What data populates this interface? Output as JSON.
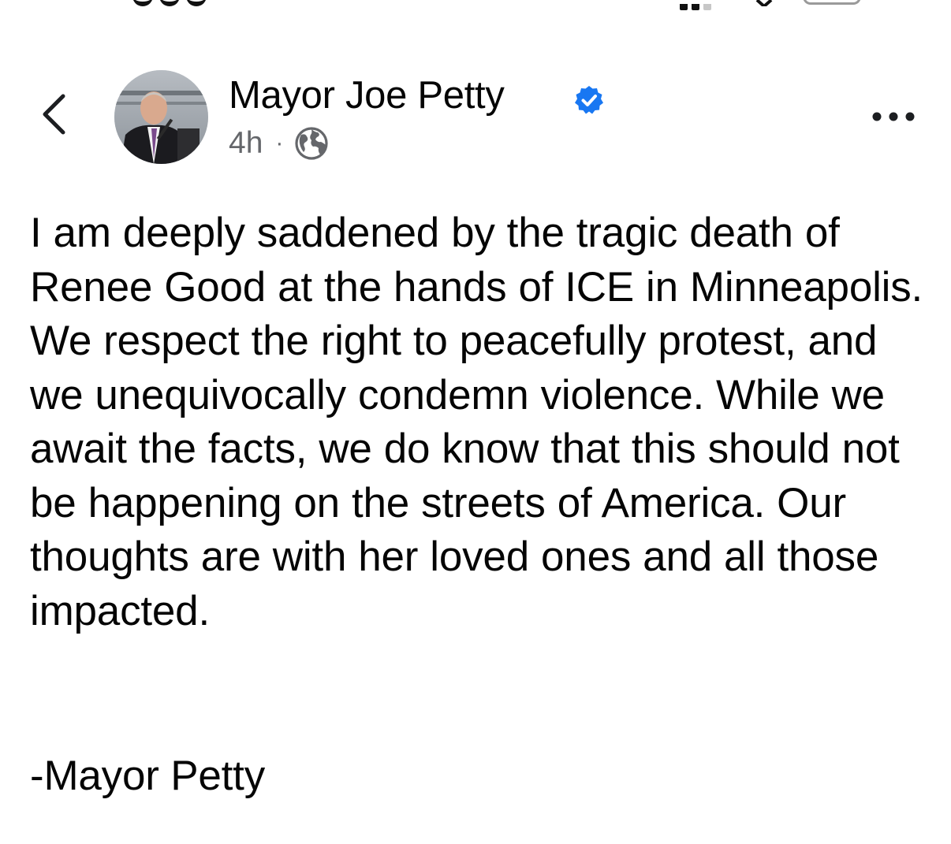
{
  "post": {
    "author_name": "Mayor Joe Petty",
    "timestamp": "4h",
    "meta_separator": "·",
    "audience_icon": "globe-icon",
    "verified_icon": "verified-badge-icon",
    "text": "I am deeply saddened by the tragic death of Renee Good at the hands of ICE in Minneapolis. We respect the right to peacefully protest, and we unequivocally condemn violence. While we await the facts, we do know that this should not be happening on the streets of America. Our thoughts are with her loved ones and all those impacted.",
    "signature": "-Mayor Petty"
  },
  "header": {
    "back_icon": "chevron-left-icon",
    "more_icon": "more-horizontal-icon"
  },
  "colors": {
    "verified_blue": "#1877f2",
    "meta_gray": "#65676b",
    "text": "#050505"
  }
}
